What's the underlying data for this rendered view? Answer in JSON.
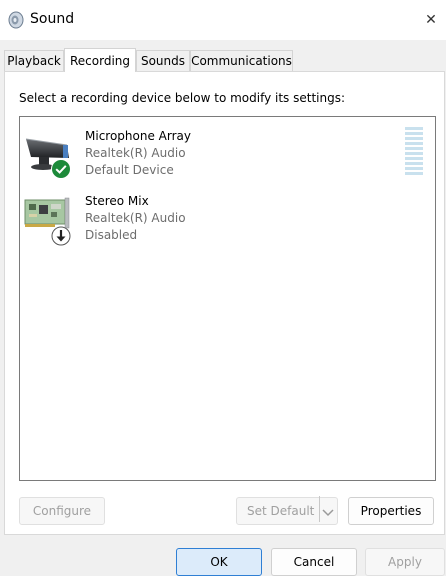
{
  "window": {
    "title": "Sound",
    "close_glyph": "✕"
  },
  "tabs": [
    {
      "label": "Playback",
      "active": false
    },
    {
      "label": "Recording",
      "active": true
    },
    {
      "label": "Sounds",
      "active": false
    },
    {
      "label": "Communications",
      "active": false
    }
  ],
  "recording": {
    "instruction": "Select a recording device below to modify its settings:",
    "devices": [
      {
        "name": "Microphone Array",
        "driver": "Realtek(R) Audio",
        "status": "Default Device",
        "icon": "microphone-array-icon",
        "badge": "default-check-badge",
        "badge_color": "#1d8a3a"
      },
      {
        "name": "Stereo Mix",
        "driver": "Realtek(R) Audio",
        "status": "Disabled",
        "icon": "sound-card-icon",
        "badge": "disabled-arrow-badge",
        "badge_color": "#222222"
      }
    ],
    "level_meter_color": "#c9e1ee"
  },
  "buttons": {
    "configure": "Configure",
    "set_default": "Set Default",
    "properties": "Properties",
    "ok": "OK",
    "cancel": "Cancel",
    "apply": "Apply"
  },
  "colors": {
    "accent": "#2f7fd4",
    "window_bg": "#f0f0f0",
    "panel_bg": "#ffffff",
    "secondary_text": "#6d6d6d",
    "disabled_text": "#a0a0a0"
  }
}
